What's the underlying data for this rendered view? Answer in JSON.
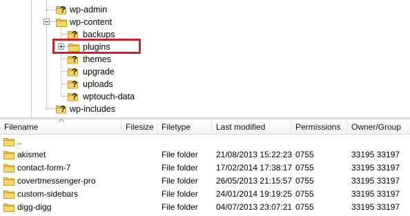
{
  "tree": {
    "items": [
      {
        "label": "wp-admin",
        "icon": "question-folder-icon"
      },
      {
        "label": "wp-content",
        "icon": "folder-icon",
        "expanded": true
      },
      {
        "label": "backups",
        "icon": "question-folder-icon"
      },
      {
        "label": "plugins",
        "icon": "folder-icon",
        "highlighted": true
      },
      {
        "label": "themes",
        "icon": "question-folder-icon"
      },
      {
        "label": "upgrade",
        "icon": "question-folder-icon"
      },
      {
        "label": "uploads",
        "icon": "question-folder-icon"
      },
      {
        "label": "wptouch-data",
        "icon": "question-folder-icon"
      },
      {
        "label": "wp-includes",
        "icon": "question-folder-icon"
      }
    ]
  },
  "file_list": {
    "columns": [
      "Filename",
      "Filesize",
      "Filetype",
      "Last modified",
      "Permissions",
      "Owner/Group"
    ],
    "parent_entry": "..",
    "rows": [
      {
        "filename": "akismet",
        "filesize": "",
        "filetype": "File folder",
        "modified": "21/08/2013 15:22:23",
        "permissions": "0755",
        "owner": "33195 33197"
      },
      {
        "filename": "contact-form-7",
        "filesize": "",
        "filetype": "File folder",
        "modified": "17/02/2014 17:38:17",
        "permissions": "0755",
        "owner": "33195 33197"
      },
      {
        "filename": "covertmessenger-pro",
        "filesize": "",
        "filetype": "File folder",
        "modified": "26/05/2013 21:15:57",
        "permissions": "0755",
        "owner": "33195 33197"
      },
      {
        "filename": "custom-sidebars",
        "filesize": "",
        "filetype": "File folder",
        "modified": "24/01/2014 19:19:25",
        "permissions": "0755",
        "owner": "33195 33197"
      },
      {
        "filename": "digg-digg",
        "filesize": "",
        "filetype": "File folder",
        "modified": "04/07/2013 23:07:21",
        "permissions": "0755",
        "owner": "33195 33197"
      }
    ]
  },
  "colors": {
    "highlight_border": "#d11f2b",
    "folder_fill": "#f4c64a",
    "question_mark": "#1a1a1a"
  }
}
